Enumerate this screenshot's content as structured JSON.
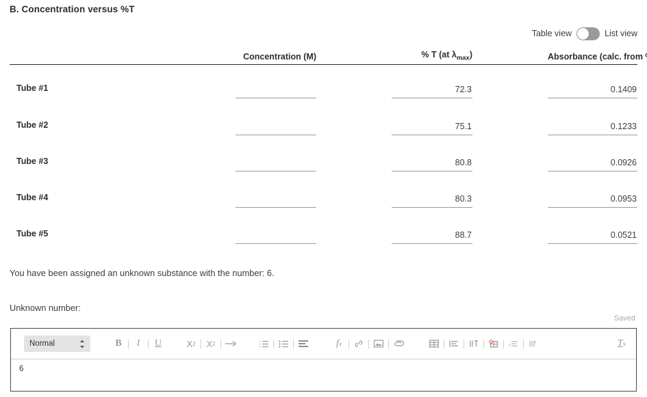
{
  "section": {
    "title": "B. Concentration versus %T"
  },
  "view_toggle": {
    "left_label": "Table view",
    "right_label": "List view",
    "state": "table",
    "track_color": "#9a9a9a",
    "knob_color": "#ffffff"
  },
  "table": {
    "columns": [
      {
        "key": "label",
        "header": ""
      },
      {
        "key": "concentration",
        "header": "Concentration (M)"
      },
      {
        "key": "percent_t",
        "header": "% T (at λmax)",
        "header_main": "% T (at λ",
        "header_sub": "max",
        "header_tail": ")"
      },
      {
        "key": "absorbance",
        "header": "Absorbance (calc. from %T)"
      }
    ],
    "rows": [
      {
        "label": "Tube #1",
        "concentration": "",
        "percent_t": "72.3",
        "absorbance": "0.1409"
      },
      {
        "label": "Tube #2",
        "concentration": "",
        "percent_t": "75.1",
        "absorbance": "0.1233"
      },
      {
        "label": "Tube #3",
        "concentration": "",
        "percent_t": "80.8",
        "absorbance": "0.0926"
      },
      {
        "label": "Tube #4",
        "concentration": "",
        "percent_t": "80.3",
        "absorbance": "0.0953"
      },
      {
        "label": "Tube #5",
        "concentration": "",
        "percent_t": "88.7",
        "absorbance": "0.0521"
      }
    ]
  },
  "body": {
    "assigned_text": "You have been assigned an unknown substance with the number: 6.",
    "unknown_prompt": "Unknown number:"
  },
  "editor": {
    "saved_status": "Saved",
    "style_value": "Normal",
    "content": "6",
    "toolbar": {
      "bold": "B",
      "italic": "I",
      "underline": "U",
      "subscript": "X2",
      "superscript": "X2",
      "indent_arrow": "→",
      "formula": "fx",
      "clear_format": "Tx"
    }
  }
}
